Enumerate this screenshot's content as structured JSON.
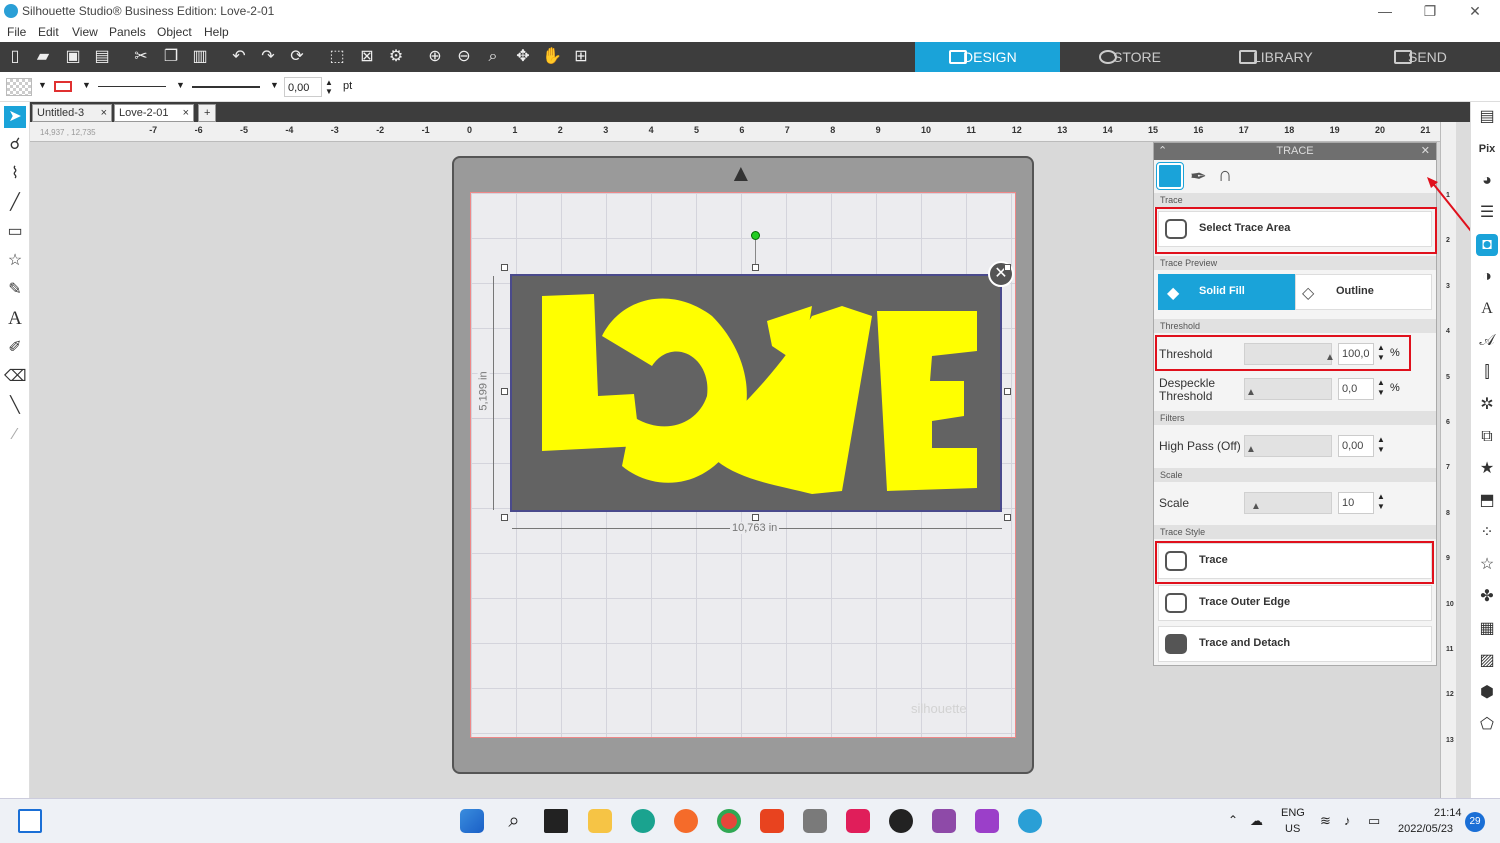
{
  "window": {
    "title": "Silhouette Studio® Business Edition: Love-2-01",
    "min": "—",
    "restore": "❐",
    "close": "✕"
  },
  "menu": [
    "File",
    "Edit",
    "View",
    "Panels",
    "Object",
    "Help"
  ],
  "nav_tabs": [
    {
      "label": "DESIGN",
      "active": true
    },
    {
      "label": "STORE",
      "active": false
    },
    {
      "label": "LIBRARY",
      "active": false
    },
    {
      "label": "SEND",
      "active": false
    }
  ],
  "line_props": {
    "width_value": "0,00",
    "unit": "pt"
  },
  "doc_tabs": [
    {
      "label": "Untitled-3"
    },
    {
      "label": "Love-2-01"
    }
  ],
  "doc_tab_close": "×",
  "doc_tab_add": "+",
  "ruler_coords": "14,937 , 12,735",
  "ruler_ticks": [
    "-7",
    "-6",
    "-5",
    "-4",
    "-3",
    "-2",
    "-1",
    "0",
    "1",
    "2",
    "3",
    "4",
    "5",
    "6",
    "7",
    "8",
    "9",
    "10",
    "11",
    "12",
    "13",
    "14",
    "15",
    "16",
    "17",
    "18",
    "19",
    "20",
    "21"
  ],
  "vruler_ticks": [
    "1",
    "2",
    "3",
    "4",
    "5",
    "6",
    "7",
    "8",
    "9",
    "10",
    "11",
    "12",
    "13"
  ],
  "design": {
    "text": "LOVE",
    "fill_color": "#ffff00",
    "width_label": "10,763 in",
    "height_label": "5,199 in",
    "watermark": "silhouette"
  },
  "trace_panel": {
    "title": "TRACE",
    "sections": {
      "trace": "Trace",
      "trace_preview": "Trace Preview",
      "threshold": "Threshold",
      "filters": "Filters",
      "scale": "Scale",
      "trace_style": "Trace Style"
    },
    "select_trace_area": "Select Trace Area",
    "preview_solid_fill": "Solid Fill",
    "preview_outline": "Outline",
    "threshold": {
      "label": "Threshold",
      "value": "100,0",
      "unit": "%",
      "level": 1.0
    },
    "despeckle": {
      "label_line1": "Despeckle",
      "label_line2": "Threshold",
      "value": "0,0",
      "unit": "%",
      "level": 0.0
    },
    "high_pass": {
      "label": "High Pass (Off)",
      "value": "0,00",
      "level": 0.0
    },
    "scale": {
      "label": "Scale",
      "value": "10",
      "level": 0.1
    },
    "styles": [
      "Trace",
      "Trace Outer Edge",
      "Trace and Detach"
    ]
  },
  "taskbar": {
    "lang_line1": "ENG",
    "lang_line2": "US",
    "time": "21:14",
    "date": "2022/05/23",
    "notifications": "29"
  },
  "colors": {
    "accent": "#1aa3d9",
    "highlight": "#e0101c",
    "toolbar": "#3d3d3d"
  }
}
